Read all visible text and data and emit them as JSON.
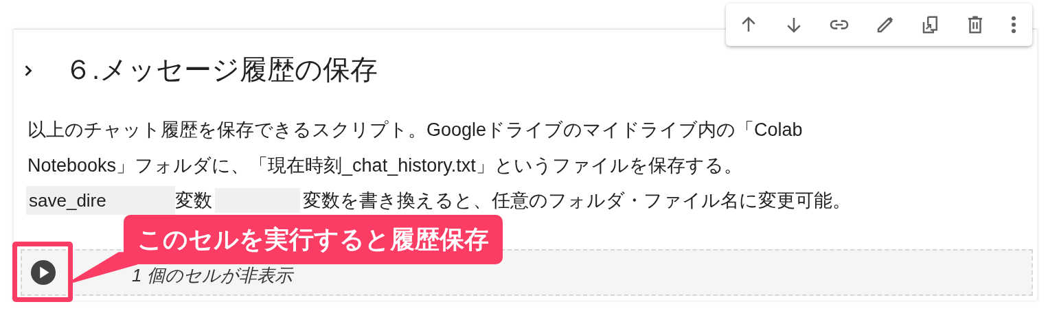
{
  "toolbar": {
    "buttons": [
      {
        "kind": "up"
      },
      {
        "kind": "down"
      },
      {
        "kind": "link"
      },
      {
        "kind": "edit"
      },
      {
        "kind": "mirror"
      },
      {
        "kind": "delete"
      },
      {
        "kind": "more"
      }
    ]
  },
  "cell": {
    "heading": "６.メッセージ履歴の保存",
    "expanded": false,
    "paragraph": "以上のチャット履歴を保存できるスクリプト。Googleドライブのマイドライブ内の「Colab Notebooks」フォルダに、「現在時刻_chat_history.txt」というファイルを保存する。",
    "line": [
      {
        "kind": "code",
        "text": "save_dire"
      },
      {
        "kind": "text",
        "text": "変数"
      },
      {
        "kind": "chip"
      },
      {
        "kind": "text",
        "text": "変数を書き換えると"
      },
      {
        "kind": "text",
        "text": "、任意のフォルダ・ファイル名に変更可能。"
      }
    ],
    "hidden_cells": "1 個のセルが非表示"
  },
  "callout": {
    "text": "このセルを実行すると履歴保存"
  }
}
